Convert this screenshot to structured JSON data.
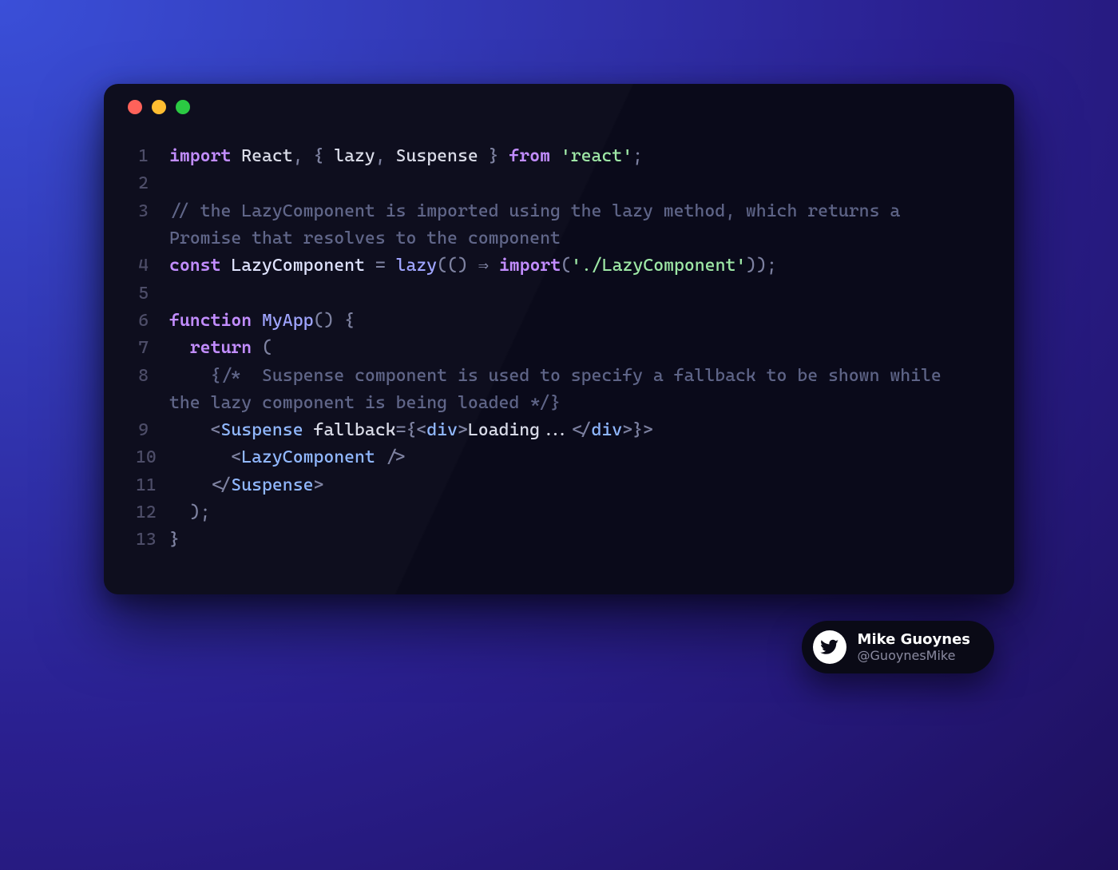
{
  "traffic_lights": [
    "red",
    "yellow",
    "green"
  ],
  "code": {
    "lines": [
      {
        "n": "1",
        "tokens": [
          {
            "c": "tk-kw",
            "t": "import"
          },
          {
            "c": "",
            "t": " "
          },
          {
            "c": "tk-ident",
            "t": "React"
          },
          {
            "c": "tk-punc",
            "t": ", { "
          },
          {
            "c": "tk-ident",
            "t": "lazy"
          },
          {
            "c": "tk-punc",
            "t": ", "
          },
          {
            "c": "tk-ident",
            "t": "Suspense"
          },
          {
            "c": "tk-punc",
            "t": " } "
          },
          {
            "c": "tk-kw",
            "t": "from"
          },
          {
            "c": "",
            "t": " "
          },
          {
            "c": "tk-str",
            "t": "'react'"
          },
          {
            "c": "tk-punc",
            "t": ";"
          }
        ]
      },
      {
        "n": "2",
        "tokens": [
          {
            "c": "",
            "t": " "
          }
        ]
      },
      {
        "n": "3",
        "tokens": [
          {
            "c": "tk-comment",
            "t": "// the LazyComponent is imported using the lazy method, which returns a Promise that resolves to the component"
          }
        ]
      },
      {
        "n": "4",
        "tokens": [
          {
            "c": "tk-kw",
            "t": "const"
          },
          {
            "c": "",
            "t": " "
          },
          {
            "c": "tk-type",
            "t": "LazyComponent"
          },
          {
            "c": "",
            "t": " "
          },
          {
            "c": "tk-op",
            "t": "="
          },
          {
            "c": "",
            "t": " "
          },
          {
            "c": "tk-func",
            "t": "lazy"
          },
          {
            "c": "tk-punc",
            "t": "(() "
          },
          {
            "c": "tk-op",
            "t": "⇒"
          },
          {
            "c": "",
            "t": " "
          },
          {
            "c": "tk-kw",
            "t": "import"
          },
          {
            "c": "tk-punc",
            "t": "("
          },
          {
            "c": "tk-str",
            "t": "'./LazyComponent'"
          },
          {
            "c": "tk-punc",
            "t": "));"
          }
        ]
      },
      {
        "n": "5",
        "tokens": [
          {
            "c": "",
            "t": " "
          }
        ]
      },
      {
        "n": "6",
        "tokens": [
          {
            "c": "tk-kw",
            "t": "function"
          },
          {
            "c": "",
            "t": " "
          },
          {
            "c": "tk-func",
            "t": "MyApp"
          },
          {
            "c": "tk-punc",
            "t": "() {"
          }
        ]
      },
      {
        "n": "7",
        "tokens": [
          {
            "c": "",
            "t": "  "
          },
          {
            "c": "tk-kw",
            "t": "return"
          },
          {
            "c": "",
            "t": " "
          },
          {
            "c": "tk-punc",
            "t": "("
          }
        ]
      },
      {
        "n": "8",
        "tokens": [
          {
            "c": "",
            "t": "    "
          },
          {
            "c": "tk-comment",
            "t": "{/*  Suspense component is used to specify a fallback to be shown while the lazy component is being loaded */}"
          }
        ]
      },
      {
        "n": "9",
        "tokens": [
          {
            "c": "",
            "t": "    "
          },
          {
            "c": "tk-punc",
            "t": "<"
          },
          {
            "c": "tk-tag",
            "t": "Suspense"
          },
          {
            "c": "",
            "t": " "
          },
          {
            "c": "tk-ident",
            "t": "fallback"
          },
          {
            "c": "tk-op",
            "t": "="
          },
          {
            "c": "tk-punc",
            "t": "{<"
          },
          {
            "c": "tk-tag",
            "t": "div"
          },
          {
            "c": "tk-punc",
            "t": ">"
          },
          {
            "c": "tk-ident",
            "t": "Loading..."
          },
          {
            "c": "tk-punc",
            "t": "</"
          },
          {
            "c": "tk-tag",
            "t": "div"
          },
          {
            "c": "tk-punc",
            "t": ">}>"
          }
        ]
      },
      {
        "n": "10",
        "tokens": [
          {
            "c": "",
            "t": "      "
          },
          {
            "c": "tk-punc",
            "t": "<"
          },
          {
            "c": "tk-tag",
            "t": "LazyComponent"
          },
          {
            "c": "",
            "t": " "
          },
          {
            "c": "tk-punc",
            "t": "/>"
          }
        ]
      },
      {
        "n": "11",
        "tokens": [
          {
            "c": "",
            "t": "    "
          },
          {
            "c": "tk-punc",
            "t": "</"
          },
          {
            "c": "tk-tag",
            "t": "Suspense"
          },
          {
            "c": "tk-punc",
            "t": ">"
          }
        ]
      },
      {
        "n": "12",
        "tokens": [
          {
            "c": "",
            "t": "  "
          },
          {
            "c": "tk-punc",
            "t": ");"
          }
        ]
      },
      {
        "n": "13",
        "tokens": [
          {
            "c": "tk-punc",
            "t": "}"
          }
        ]
      }
    ]
  },
  "author": {
    "name": "Mike Guoynes",
    "handle": "@GuoynesMike"
  }
}
